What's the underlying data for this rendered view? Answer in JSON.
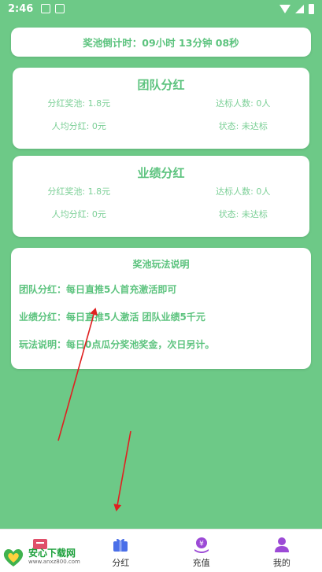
{
  "status_bar": {
    "time": "2:46"
  },
  "countdown": {
    "text": "奖池倒计时：09小时 13分钟 08秒"
  },
  "team_panel": {
    "title": "团队分红",
    "pool": "分红奖池: 1.8元",
    "reached": "达标人数: 0人",
    "avg": "人均分红: 0元",
    "status": "状态: 未达标"
  },
  "perf_panel": {
    "title": "业绩分红",
    "pool": "分红奖池: 1.8元",
    "reached": "达标人数: 0人",
    "avg": "人均分红: 0元",
    "status": "状态: 未达标"
  },
  "rules": {
    "title": "奖池玩法说明",
    "line1": "团队分红：每日直推5人首充激活即可",
    "line2": "业绩分红：每日直推5人激活 团队业绩5千元",
    "line3": "玩法说明：每日0点瓜分奖池奖金，次日另计。"
  },
  "tabbar": {
    "tabs": [
      {
        "label": "",
        "icon": "home-icon"
      },
      {
        "label": "分红",
        "icon": "gift-icon"
      },
      {
        "label": "充值",
        "icon": "recharge-icon"
      },
      {
        "label": "我的",
        "icon": "profile-icon"
      }
    ]
  },
  "watermark": {
    "title": "安心下载网",
    "subtitle": "www.anxz800.com"
  },
  "colors": {
    "background": "#6dc987",
    "accent": "#5cc37e",
    "arrow": "#e02020",
    "tab_icon": "#4a6fe8",
    "recharge_icon": "#9c4ad6"
  }
}
